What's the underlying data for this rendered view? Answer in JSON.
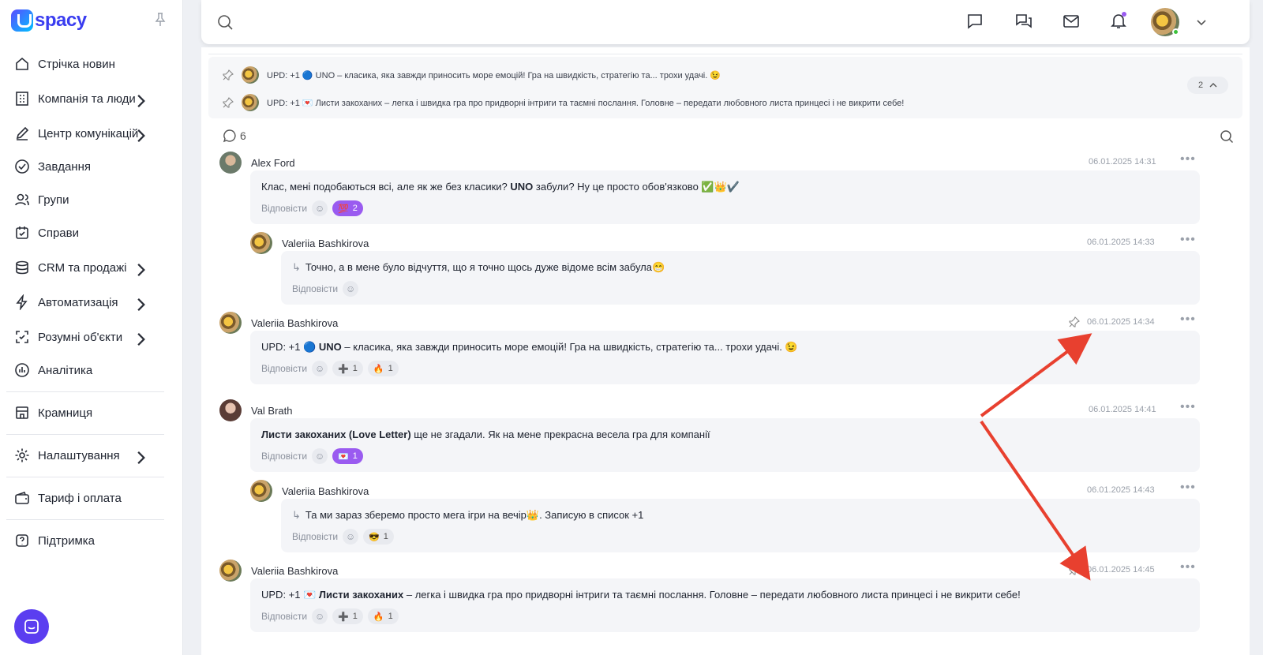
{
  "app": {
    "logo": "spacy"
  },
  "sidebar": {
    "items": [
      {
        "label": "Стрічка новин",
        "chevron": false,
        "icon": "home-icon"
      },
      {
        "label": "Компанія та люди",
        "chevron": true,
        "icon": "building-icon"
      },
      {
        "label": "Центр комунікацій",
        "chevron": true,
        "icon": "edit-icon"
      },
      {
        "label": "Завдання",
        "chevron": false,
        "icon": "check-circle-icon"
      },
      {
        "label": "Групи",
        "chevron": false,
        "icon": "users-icon"
      },
      {
        "label": "Справи",
        "chevron": false,
        "icon": "calendar-icon"
      },
      {
        "label": "CRM та продажі",
        "chevron": true,
        "icon": "database-icon"
      },
      {
        "label": "Автоматизація",
        "chevron": true,
        "icon": "lightning-icon"
      },
      {
        "label": "Розумні об'єкти",
        "chevron": true,
        "icon": "smart-object-icon"
      },
      {
        "label": "Аналітика",
        "chevron": false,
        "icon": "chart-icon"
      },
      {
        "label": "Крамниця",
        "chevron": false,
        "icon": "store-icon"
      },
      {
        "label": "Налаштування",
        "chevron": true,
        "icon": "gear-icon"
      },
      {
        "label": "Тариф і оплата",
        "chevron": false,
        "icon": "wallet-icon"
      },
      {
        "label": "Підтримка",
        "chevron": false,
        "icon": "help-icon"
      }
    ]
  },
  "pinned": {
    "count": "2",
    "items": [
      {
        "text": "UPD: +1 🔵 UNO – класика, яка завжди приносить море емоцій! Гра на швидкість, стратегію та... трохи удачі. 😉"
      },
      {
        "text": "UPD: +1 💌 Листи закоханих – легка і швидка гра про придворні інтриги та таємні послання. Головне – передати любовного листа принцесі і не викрити себе!"
      }
    ]
  },
  "comments": {
    "count": "6",
    "reply_label": "Відповісти",
    "messages": [
      {
        "author": "Alex Ford",
        "date": "06.01.2025 14:31",
        "text_before": "Клас, мені подобаються всі, але як же без класики? ",
        "bold": "UNO",
        "text_after": " забули? Ну це просто обов'язково ✅👑✔️",
        "reactions": [
          {
            "emoji": "💯",
            "count": "2",
            "active": true
          }
        ]
      },
      {
        "author": "Valeriia Bashkirova",
        "date": "06.01.2025 14:33",
        "text_before": "Точно, а в мене було відчуття, що я точно щось дуже відоме всім забула😁",
        "bold": "",
        "text_after": "",
        "reactions": []
      },
      {
        "author": "Valeriia Bashkirova",
        "date": "06.01.2025 14:34",
        "text_before": "UPD: +1 🔵 ",
        "bold": "UNO",
        "text_after": "  – класика, яка завжди приносить море емоцій! Гра на швидкість, стратегію та... трохи удачі. 😉",
        "reactions": [
          {
            "emoji": "➕",
            "count": "1",
            "active": false
          },
          {
            "emoji": "🔥",
            "count": "1",
            "active": false
          }
        ]
      },
      {
        "author": "Val Brath",
        "date": "06.01.2025 14:41",
        "text_before": "",
        "bold": "Листи закоханих (Love Letter)",
        "text_after": " ще не згадали. Як на мене прекрасна весела гра для компанії",
        "reactions": [
          {
            "emoji": "💌",
            "count": "1",
            "active": true
          }
        ]
      },
      {
        "author": "Valeriia Bashkirova",
        "date": "06.01.2025 14:43",
        "text_before": "Та ми зараз зберемо просто мега ігри на вечір👑. Записую в список +1",
        "bold": "",
        "text_after": "",
        "reactions": [
          {
            "emoji": "😎",
            "count": "1",
            "active": false
          }
        ]
      },
      {
        "author": "Valeriia Bashkirova",
        "date": "06.01.2025 14:45",
        "text_before": "UPD: +1 💌 ",
        "bold": "Листи закоханих",
        "text_after": " – легка і швидка гра про придворні інтриги та таємні послання. Головне – передати любовного листа принцесі і не викрити себе!",
        "reactions": [
          {
            "emoji": "➕",
            "count": "1",
            "active": false
          },
          {
            "emoji": "🔥",
            "count": "1",
            "active": false
          }
        ]
      }
    ]
  },
  "colors": {
    "accent": "#5b3ef0",
    "reaction_active": "#9a5bf0",
    "annotation_arrow": "#e8402f",
    "online": "#3cc13b"
  }
}
